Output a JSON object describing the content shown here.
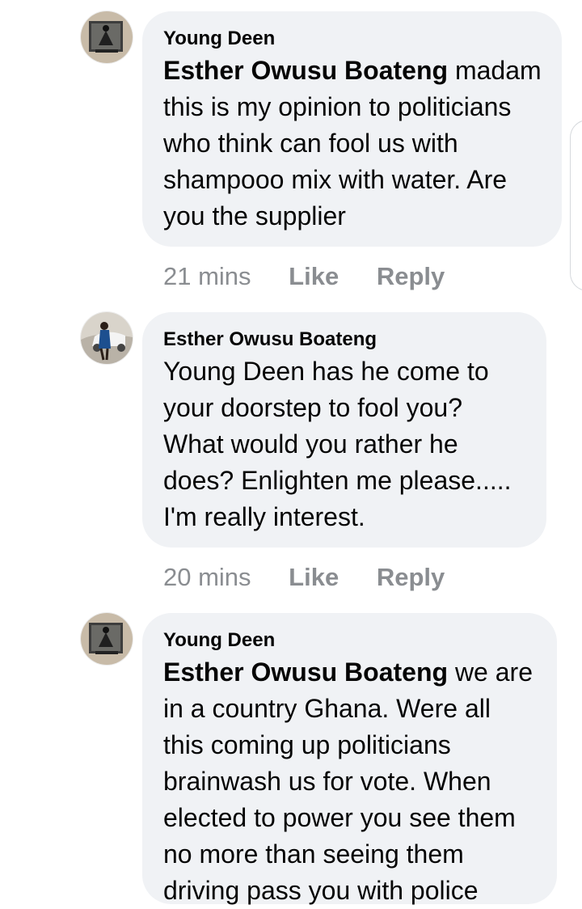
{
  "comments": [
    {
      "author": "Young Deen",
      "mention": "Esther Owusu Boateng",
      "text_lines": [
        " madam",
        "this is my opinion to politicians",
        "who think can fool us with",
        "shampooo mix with water. Are",
        "you the supplier"
      ],
      "meta": {
        "time": "21 mins",
        "like": "Like",
        "reply": "Reply"
      },
      "avatar": "profile-avatar-young-deen"
    },
    {
      "author": "Esther Owusu Boateng",
      "text_lines": [
        "Young Deen has he come to",
        "your doorstep to fool you?",
        "What would you rather he",
        "does? Enlighten me please.....",
        "I'm really interest."
      ],
      "meta": {
        "time": "20 mins",
        "like": "Like",
        "reply": "Reply"
      },
      "avatar": "profile-avatar-esther-owusu-boateng"
    },
    {
      "author": "Young Deen",
      "mention": "Esther Owusu Boateng",
      "text_lines": [
        " we are",
        "in a country Ghana.  Were all",
        "this coming up politicians",
        "brainwash us for vote.  When",
        "elected to power you see them",
        "no more than seeing them",
        "driving pass you with police"
      ],
      "avatar": "profile-avatar-young-deen"
    }
  ],
  "colors": {
    "bubble_background": "#f0f2f5",
    "text": "#050505",
    "meta_text": "#8a8d91"
  }
}
